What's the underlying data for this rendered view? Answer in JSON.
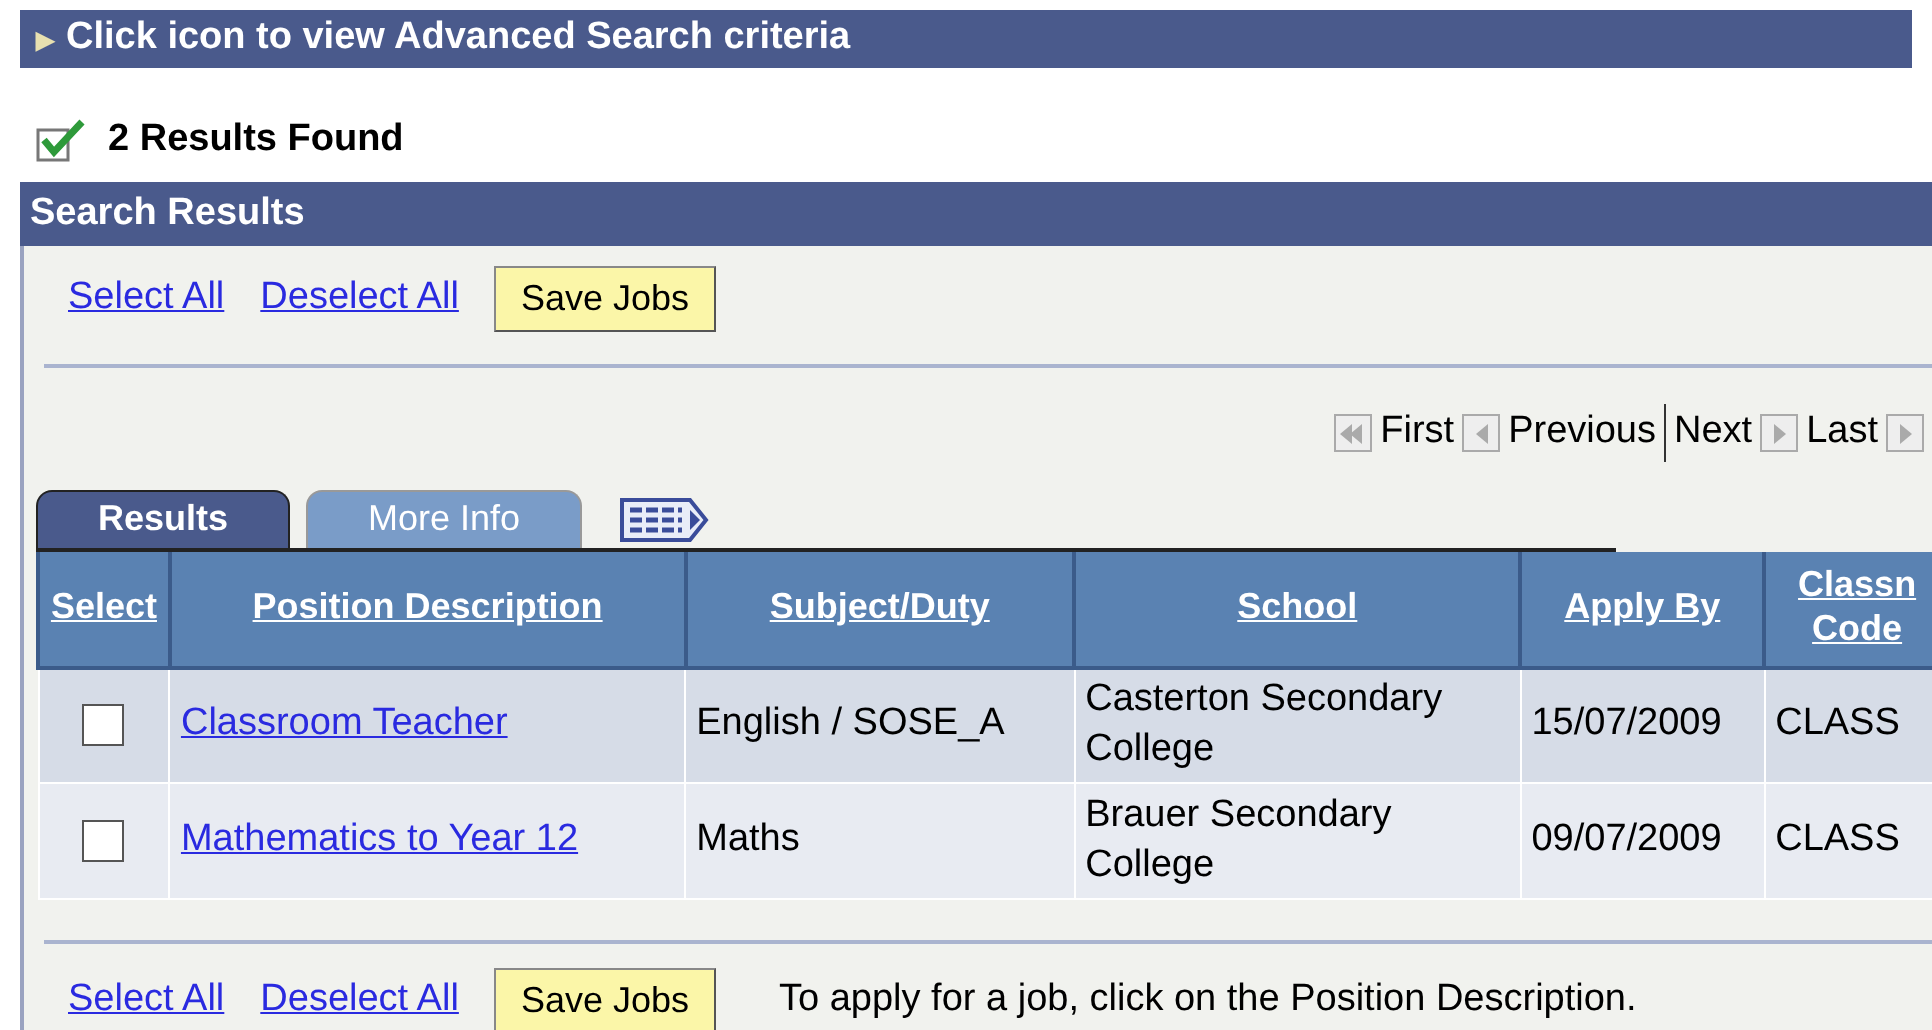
{
  "advanced_bar": {
    "icon": "▶",
    "label": "Click icon to view Advanced Search criteria"
  },
  "status": {
    "text": "2 Results Found"
  },
  "panel": {
    "title": "Search Results",
    "top_actions": {
      "links": [
        "Select All",
        "Deselect All"
      ],
      "button": "Save Jobs"
    },
    "pager": [
      "First",
      "Previous",
      "Next",
      "Last"
    ],
    "tabs": [
      {
        "label": "Results",
        "selected": true
      },
      {
        "label": "More Info",
        "selected": false
      }
    ],
    "table": {
      "columns": [
        "Select",
        "Position Description",
        "Subject/Duty",
        "School",
        "Apply By",
        "Classn Code"
      ],
      "rows": [
        {
          "checked": false,
          "position": "Classroom Teacher",
          "subject": "English / SOSE_A",
          "school": "Casterton Secondary College",
          "apply_by": "15/07/2009",
          "code": "CLASS"
        },
        {
          "checked": false,
          "position": "Mathematics to Year 12",
          "subject": "Maths",
          "school": "Brauer Secondary College",
          "apply_by": "09/07/2009",
          "code": "CLASS"
        }
      ]
    },
    "bottom_actions": {
      "links": [
        "Select All",
        "Deselect All"
      ],
      "button": "Save Jobs",
      "note": "To apply for a job, click on the Position Description."
    }
  }
}
